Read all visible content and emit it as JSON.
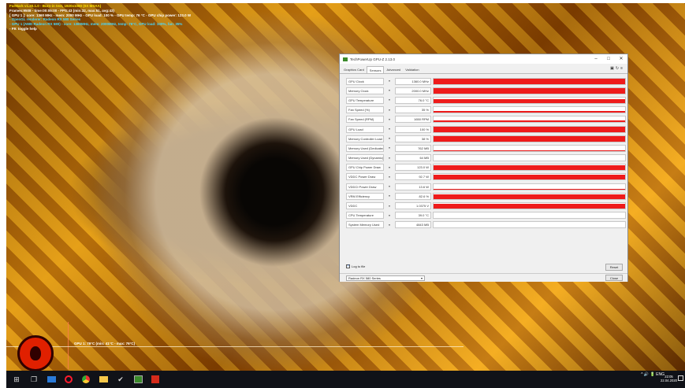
{
  "osd": {
    "line1": "FurMark v1.20.1.0 - Burn-in test, 1920x1080 (0X MSAA)",
    "line2": "Frames:9508 - time:00:05:00 - FPS:43 (min:32, max:51, avg:43)",
    "line3": "[ GPU 1 ]: core: 1360 MHz - mem: 2000 MHz - GPU load: 100 % - GPU temp: 76 °C - GPU chip power: 123.0 W",
    "line4": "- OpenGL renderer: Radeon RX 580 Series",
    "line5": "- GPU 1 (AMD Radeon RX 580) - core: 1360MHz, mem: 2000MHz, temp: 76°C, GPU load: 100%, fan: 35%",
    "line6": "- F9: toggle help"
  },
  "graph_label": "GPU 1: 76°C (min: 41°C - max: 76°C)",
  "window": {
    "title": "TechPowerUp GPU-Z 2.13.0",
    "controls": {
      "minimize": "–",
      "maximize": "□",
      "close": "✕"
    },
    "tabs": [
      {
        "label": "Graphics Card",
        "active": false
      },
      {
        "label": "Sensors",
        "active": true
      },
      {
        "label": "Advanced",
        "active": false
      },
      {
        "label": "Validation",
        "active": false
      }
    ],
    "toolbar_icons": [
      "camera-icon",
      "refresh-icon",
      "menu-icon"
    ],
    "sensors": [
      {
        "name": "GPU Clock",
        "value": "1360.0 MHz",
        "level": 0.95
      },
      {
        "name": "Memory Clock",
        "value": "2000.0 MHz",
        "level": 0.95
      },
      {
        "name": "GPU Temperature",
        "value": "76.0 °C",
        "level": 0.75
      },
      {
        "name": "Fan Speed (%)",
        "value": "35 %",
        "level": 0.3
      },
      {
        "name": "Fan Speed (RPM)",
        "value": "1650 RPM",
        "level": 0.35
      },
      {
        "name": "GPU Load",
        "value": "100 %",
        "level": 0.95
      },
      {
        "name": "Memory Controller Load",
        "value": "38 %",
        "level": 0.9
      },
      {
        "name": "Memory Used (Dedicated)",
        "value": "762 MB",
        "level": 0.1
      },
      {
        "name": "Memory Used (Dynamic)",
        "value": "64 MB",
        "level": 0.05
      },
      {
        "name": "GPU Chip Power Draw",
        "value": "123.0 W",
        "level": 0.9
      },
      {
        "name": "VDDC Power Draw",
        "value": "92.7 W",
        "level": 0.88
      },
      {
        "name": "VDDCI Power Draw",
        "value": "13.6 W",
        "level": 0.15
      },
      {
        "name": "VRM Efficiency",
        "value": "82.6 %",
        "level": 0.85
      },
      {
        "name": "VDDC",
        "value": "1.0375 V",
        "level": 0.82
      },
      {
        "name": "CPU Temperature",
        "value": "39.0 °C",
        "level": 0.1
      },
      {
        "name": "System Memory Used",
        "value": "4843 MB",
        "level": 0.1
      }
    ],
    "log_label": "Log to file",
    "reset_label": "Reset",
    "gpu_selected": "Radeon RX 580 Series",
    "close_label": "Close"
  },
  "taskbar": {
    "apps": [
      "windows-start-icon",
      "task-view-icon",
      "file-explorer-icon",
      "opera-icon",
      "chrome-icon",
      "mail-icon",
      "store-icon",
      "gpuz-icon",
      "furmark-icon"
    ],
    "tray_text": "^ 🔊 🔋 ENG",
    "time": "22:05",
    "date": "22.04.2020"
  },
  "colors": {
    "graph_fill": "#ee1b1b",
    "osd_yellow": "#ffe800",
    "osd_cyan": "#46d7ff",
    "taskbar": "#101218"
  }
}
